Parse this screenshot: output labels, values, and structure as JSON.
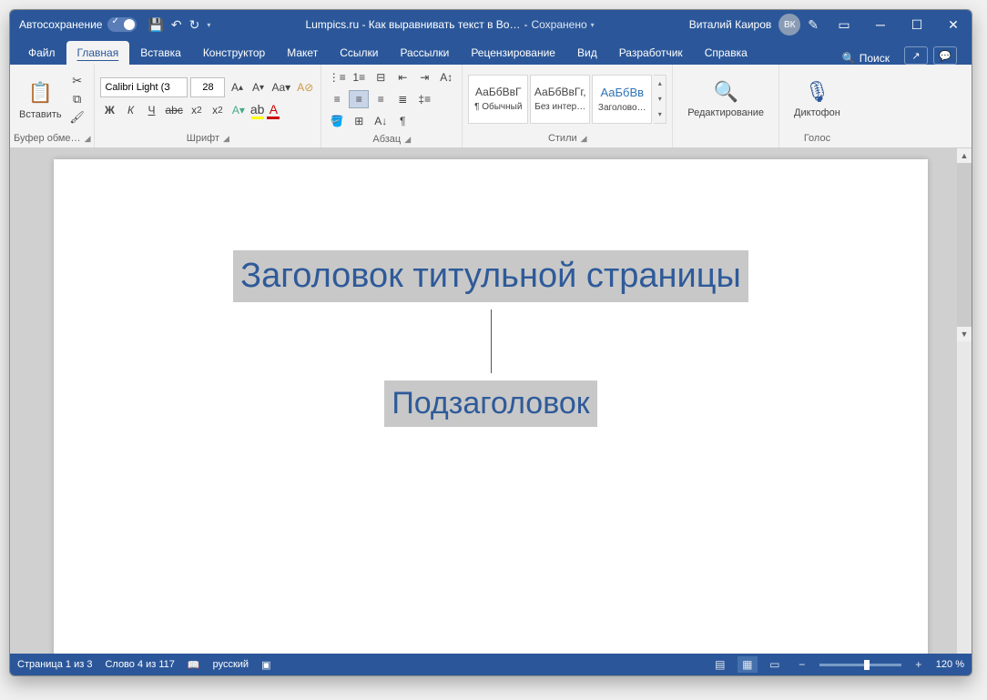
{
  "titlebar": {
    "autosave": "Автосохранение",
    "doc_title": "Lumpics.ru - Как выравнивать текст в Во…",
    "saved": "Сохранено",
    "user": "Виталий Каиров",
    "initials": "ВК"
  },
  "tabs": {
    "file": "Файл",
    "home": "Главная",
    "insert": "Вставка",
    "design": "Конструктор",
    "layout": "Макет",
    "references": "Ссылки",
    "mailings": "Рассылки",
    "review": "Рецензирование",
    "view": "Вид",
    "developer": "Разработчик",
    "help": "Справка",
    "search": "Поиск"
  },
  "ribbon": {
    "clipboard": {
      "label": "Буфер обме…",
      "paste": "Вставить"
    },
    "font": {
      "label": "Шрифт",
      "name": "Calibri Light (З",
      "size": "28",
      "bold": "Ж",
      "italic": "К",
      "underline": "Ч",
      "strike": "abc"
    },
    "paragraph": {
      "label": "Абзац"
    },
    "styles": {
      "label": "Стили",
      "normal": {
        "preview": "АаБбВвГ",
        "label": "¶ Обычный"
      },
      "nospace": {
        "preview": "АаБбВвГг,",
        "label": "Без интер…"
      },
      "h1": {
        "preview": "АаБбВв",
        "label": "Заголово…"
      }
    },
    "editing": {
      "label": "Редактирование"
    },
    "voice": {
      "label": "Голос",
      "dictate": "Диктофон"
    }
  },
  "document": {
    "heading": "Заголовок титульной страницы",
    "subheading": "Подзаголовок"
  },
  "statusbar": {
    "page": "Страница 1 из 3",
    "words": "Слово 4 из 117",
    "lang": "русский",
    "zoom": "120 %"
  }
}
